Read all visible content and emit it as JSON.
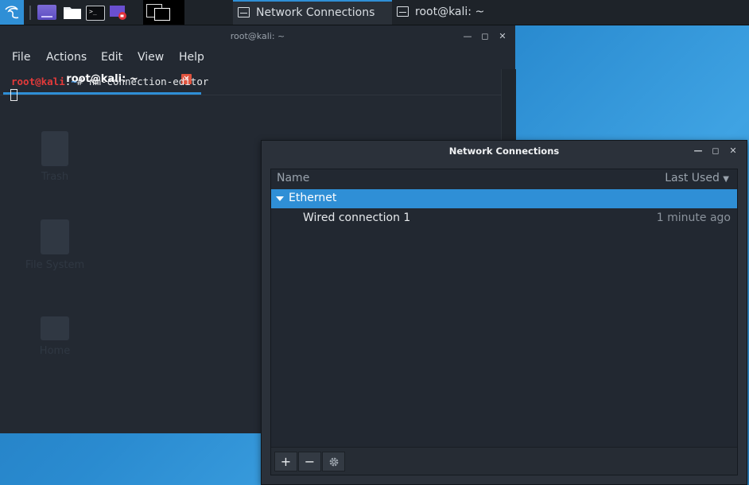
{
  "taskbar": {
    "tasks": [
      {
        "label": "Network Connections",
        "active": true
      },
      {
        "label": "root@kali: ~",
        "active": false
      }
    ]
  },
  "terminal": {
    "title": "root@kali: ~",
    "menu": [
      "File",
      "Actions",
      "Edit",
      "View",
      "Help"
    ],
    "tab_label": "root@kali: ~",
    "prompt_user": "root@kali",
    "prompt_sep": ":",
    "prompt_path": "~",
    "prompt_symbol": "# ",
    "command": "nm-connection-editor"
  },
  "desktop_icons": [
    {
      "label": "Trash",
      "icon": "trash-icon"
    },
    {
      "label": "File System",
      "icon": "drive-icon"
    },
    {
      "label": "Home",
      "icon": "home-icon"
    }
  ],
  "network_connections": {
    "title": "Network Connections",
    "columns": {
      "name": "Name",
      "last_used": "Last Used"
    },
    "group": "Ethernet",
    "connections": [
      {
        "name": "Wired connection 1",
        "last_used": "1 minute ago"
      }
    ],
    "toolbar": {
      "add": "+",
      "remove": "−"
    }
  },
  "colors": {
    "accent": "#2f8fd6",
    "prompt_user": "#e33a3a",
    "prompt_path": "#4f9ee8",
    "close_tab": "#e0533e"
  }
}
